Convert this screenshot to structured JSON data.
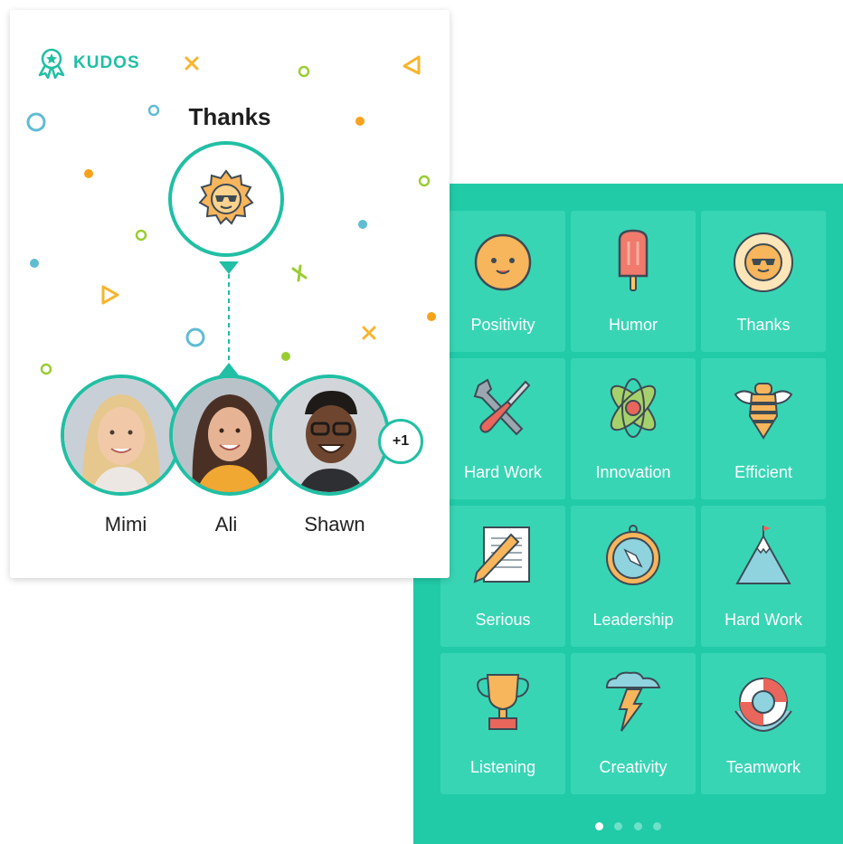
{
  "card": {
    "logo_text": "KUDOS",
    "title": "Thanks",
    "recipients": [
      {
        "name": "Mimi"
      },
      {
        "name": "Ali"
      },
      {
        "name": "Shawn"
      }
    ],
    "more_count": "+1"
  },
  "categories": [
    {
      "label": "Positivity",
      "icon": "smiley-face-icon"
    },
    {
      "label": "Humor",
      "icon": "popsicle-icon"
    },
    {
      "label": "Thanks",
      "icon": "sun-sunglasses-icon"
    },
    {
      "label": "Hard Work",
      "icon": "wrench-screwdriver-icon"
    },
    {
      "label": "Innovation",
      "icon": "atom-icon"
    },
    {
      "label": "Efficient",
      "icon": "bee-icon"
    },
    {
      "label": "Serious",
      "icon": "document-pencil-icon"
    },
    {
      "label": "Leadership",
      "icon": "compass-icon"
    },
    {
      "label": "Hard Work",
      "icon": "mountain-flag-icon"
    },
    {
      "label": "Listening",
      "icon": "trophy-icon"
    },
    {
      "label": "Creativity",
      "icon": "lightning-cloud-icon"
    },
    {
      "label": "Teamwork",
      "icon": "lifebuoy-icon"
    }
  ],
  "pagination": {
    "pages": 4,
    "current": 1
  },
  "colors": {
    "accent": "#21bfa4",
    "panel": "#21cba8",
    "tile": "#38d5b5"
  }
}
